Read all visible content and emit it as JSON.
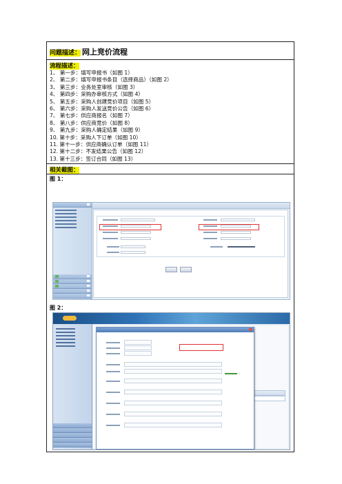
{
  "header": {
    "label": "问题描述：",
    "title": "网上竞价流程"
  },
  "process": {
    "label": "流程描述：",
    "steps": [
      "1、 第一步：填写申报书（如图 1）",
      "2、 第二步：填写申报书条目（选择商品）（如图 2）",
      "3、 第三步：业务处室审核（如图 3）",
      "4、 第四步：采购办审核方式（如图 4）",
      "5、 第五步：采购人创建竞价项目（如图 5）",
      "6、 第六步：采购人发送竞价公告（如图 6）",
      "7、 第七步：供应商报名（如图 7）",
      "8、 第八步：供应商竞价（如图 8）",
      "9、 第九步：采购人确定结果（如图 9）",
      "10. 第十步：采购人下订单（如图 10）",
      "11. 第十一步：供应商确认订单（如图 11）",
      "12. 第十二步：不发结果公告（如图 12）",
      "13. 第十三步：签订合同（如图 13）"
    ]
  },
  "screenshots": {
    "label": "相关截图：",
    "fig1_label": "图 1：",
    "fig2_label": "图 2："
  },
  "colors": {
    "highlight": "#f0f000",
    "border": "#222222",
    "callout": "#e03030"
  }
}
